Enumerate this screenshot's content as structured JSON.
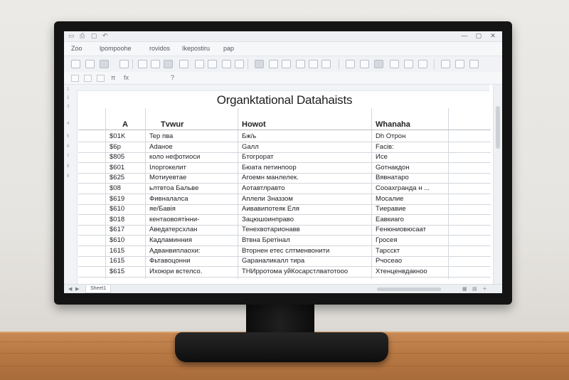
{
  "window": {
    "title_glyphs": [
      "▭",
      "⎙",
      "▢",
      "↶"
    ],
    "controls": [
      "—",
      "▢",
      "✕"
    ]
  },
  "menu": {
    "items": [
      "Zoo",
      "lpompoohe",
      "rovidos",
      "Ikepostiru",
      "pap"
    ]
  },
  "formula": {
    "name_box": "π",
    "fx": "fx",
    "value": "?"
  },
  "sheet": {
    "title": "Organktational Datahaists",
    "headers": [
      "A",
      "Tvwur",
      "Howot",
      "Whanaha"
    ],
    "rows": [
      [
        "$01K",
        "Tep пва",
        "Бж/ь",
        "Dh Отрон"
      ],
      [
        "$6p",
        "Adaное",
        "Gaлл",
        "Faсів:"
      ],
      [
        "$805",
        "коло нефотиоси",
        "Бтогрорат",
        "Исе"
      ],
      [
        "$601",
        "Ілоргокелит",
        "Бюата петинпоор",
        "Gотнакдон"
      ],
      [
        "$625",
        "Мотиуевтае",
        "Агоемн манлелек.",
        "Вявнатаро"
      ],
      [
        "$08",
        "ьлтвтоа Бальве",
        "Аотавтлравто",
        "Сооахгранда н ..."
      ],
      [
        "$619",
        "Фивналалса",
        "Аплели Зназзом",
        "Мосалие"
      ],
      [
        "$610",
        "яе/Бавія",
        "Аивавипотеяк Еля",
        "Tиеравие"
      ],
      [
        "$018",
        "кентаовоятінни-",
        "Зацюшоинправо",
        "Еавкиаго"
      ],
      [
        "$617",
        "Аведатерсхлан",
        "Тенехвотарионавв",
        "Fенюниовюсаат"
      ],
      [
        "$610",
        "Кадламинния",
        "Втвна Бретінал",
        "Гросея"
      ],
      [
        "1615",
        "Адванвиплаохи:",
        "Вторнен етес слтменвонити",
        "Тарсскт"
      ],
      [
        "1615",
        "Фьтавоцонни",
        "Gараналикалл тира",
        "Рчосеао"
      ],
      [
        "$615",
        "Ихоюри встелсо.",
        "ТНИрротома уйКосарстлватотооо",
        "Хтенценвдакноо"
      ]
    ]
  },
  "status": {
    "tab": "Sheet1"
  }
}
